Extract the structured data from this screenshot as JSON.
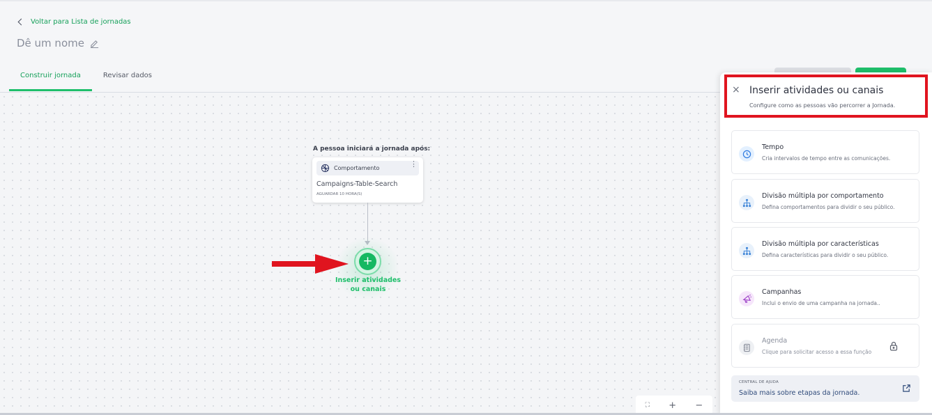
{
  "header": {
    "back_label": "Voltar para Lista de jornadas",
    "name_placeholder": "Dê um nome",
    "tabs": [
      {
        "label": "Construir jornada",
        "active": true
      },
      {
        "label": "Revisar dados",
        "active": false
      }
    ]
  },
  "canvas": {
    "start_label": "A pessoa iniciará a jornada após:",
    "trigger_card": {
      "type_label": "Comportamento",
      "title": "Campaigns-Table-Search",
      "subtitle": "AGUARDAR 10 HORA(S)"
    },
    "add_node": {
      "plus": "+",
      "label_line1": "Inserir atividades",
      "label_line2": "ou canais"
    },
    "zoom": {
      "fit": "⛶",
      "in": "+",
      "out": "−"
    }
  },
  "panel": {
    "close": "×",
    "title": "Inserir atividades ou canais",
    "subtitle": "Configure como as pessoas vão percorrer a Jornada.",
    "options": [
      {
        "title": "Tempo",
        "desc": "Cria intervalos de tempo entre as comunicações.",
        "icon": "clock-icon"
      },
      {
        "title": "Divisão múltipla por comportamento",
        "desc": "Defina comportamentos para dividir o seu público.",
        "icon": "split-icon"
      },
      {
        "title": "Divisão múltipla por características",
        "desc": "Defina características para dividir o seu público.",
        "icon": "split-icon"
      },
      {
        "title": "Campanhas",
        "desc": "Inclui o envio de uma campanha na jornada..",
        "icon": "megaphone-icon"
      },
      {
        "title": "Agenda",
        "desc": "Clique para solicitar acesso a essa função",
        "icon": "agenda-icon",
        "locked": true
      }
    ],
    "help": {
      "kicker": "CENTRAL DE AJUDA",
      "text": "Saiba mais sobre etapas da jornada."
    }
  },
  "colors": {
    "accent_green": "#1fbf6b",
    "highlight_red": "#e0141f",
    "link_blue": "#2f4a7a"
  }
}
